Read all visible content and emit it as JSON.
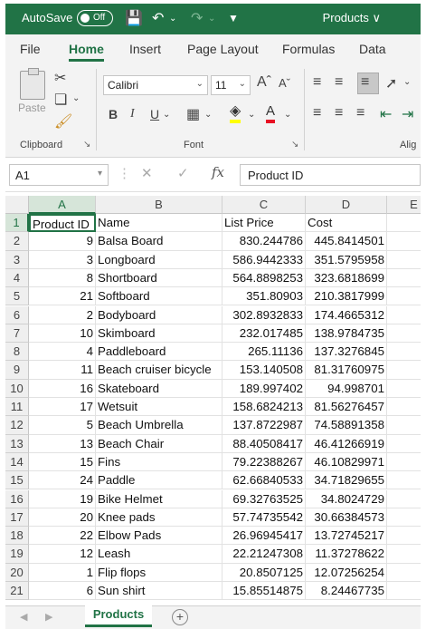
{
  "titlebar": {
    "autosave_label": "AutoSave",
    "autosave_state": "Off",
    "doc_title": "Products ∨"
  },
  "ribbon_tabs": [
    "File",
    "Home",
    "Insert",
    "Page Layout",
    "Formulas",
    "Data"
  ],
  "ribbon": {
    "paste_label": "Paste",
    "clipboard_label": "Clipboard",
    "font_label": "Font",
    "alignment_label": "Alig",
    "font_name": "Calibri",
    "font_size": "11",
    "bold": "B",
    "italic": "I",
    "underline": "U"
  },
  "formula_bar": {
    "name_box": "A1",
    "fx": "fx",
    "content": "Product ID"
  },
  "grid": {
    "columns": [
      "A",
      "B",
      "C",
      "D",
      "E"
    ],
    "header_row": [
      "Product ID",
      "Name",
      "List Price",
      "Cost"
    ],
    "rows": [
      {
        "n": "2",
        "id": "9",
        "name": "Balsa Board",
        "price": "830.244786",
        "cost": "445.8414501"
      },
      {
        "n": "3",
        "id": "3",
        "name": "Longboard",
        "price": "586.9442333",
        "cost": "351.5795958"
      },
      {
        "n": "4",
        "id": "8",
        "name": "Shortboard",
        "price": "564.8898253",
        "cost": "323.6818699"
      },
      {
        "n": "5",
        "id": "21",
        "name": "Softboard",
        "price": "351.80903",
        "cost": "210.3817999"
      },
      {
        "n": "6",
        "id": "2",
        "name": "Bodyboard",
        "price": "302.8932833",
        "cost": "174.4665312"
      },
      {
        "n": "7",
        "id": "10",
        "name": "Skimboard",
        "price": "232.017485",
        "cost": "138.9784735"
      },
      {
        "n": "8",
        "id": "4",
        "name": "Paddleboard",
        "price": "265.11136",
        "cost": "137.3276845"
      },
      {
        "n": "9",
        "id": "11",
        "name": "Beach cruiser bicycle",
        "price": "153.140508",
        "cost": "81.31760975"
      },
      {
        "n": "10",
        "id": "16",
        "name": "Skateboard",
        "price": "189.997402",
        "cost": "94.998701"
      },
      {
        "n": "11",
        "id": "17",
        "name": "Wetsuit",
        "price": "158.6824213",
        "cost": "81.56276457"
      },
      {
        "n": "12",
        "id": "5",
        "name": "Beach Umbrella",
        "price": "137.8722987",
        "cost": "74.58891358"
      },
      {
        "n": "13",
        "id": "13",
        "name": "Beach Chair",
        "price": "88.40508417",
        "cost": "46.41266919"
      },
      {
        "n": "14",
        "id": "15",
        "name": "Fins",
        "price": "79.22388267",
        "cost": "46.10829971"
      },
      {
        "n": "15",
        "id": "24",
        "name": "Paddle",
        "price": "62.66840533",
        "cost": "34.71829655"
      },
      {
        "n": "16",
        "id": "19",
        "name": "Bike Helmet",
        "price": "69.32763525",
        "cost": "34.8024729"
      },
      {
        "n": "17",
        "id": "20",
        "name": "Knee pads",
        "price": "57.74735542",
        "cost": "30.66384573"
      },
      {
        "n": "18",
        "id": "22",
        "name": "Elbow Pads",
        "price": "26.96945417",
        "cost": "13.72745217"
      },
      {
        "n": "19",
        "id": "12",
        "name": "Leash",
        "price": "22.21247308",
        "cost": "11.37278622"
      },
      {
        "n": "20",
        "id": "1",
        "name": "Flip flops",
        "price": "20.8507125",
        "cost": "12.07256254"
      },
      {
        "n": "21",
        "id": "6",
        "name": "Sun shirt",
        "price": "15.85514875",
        "cost": "8.24467735"
      }
    ]
  },
  "sheet_tabs": {
    "active": "Products",
    "add_symbol": "+"
  },
  "colors": {
    "excel_green": "#217346"
  }
}
